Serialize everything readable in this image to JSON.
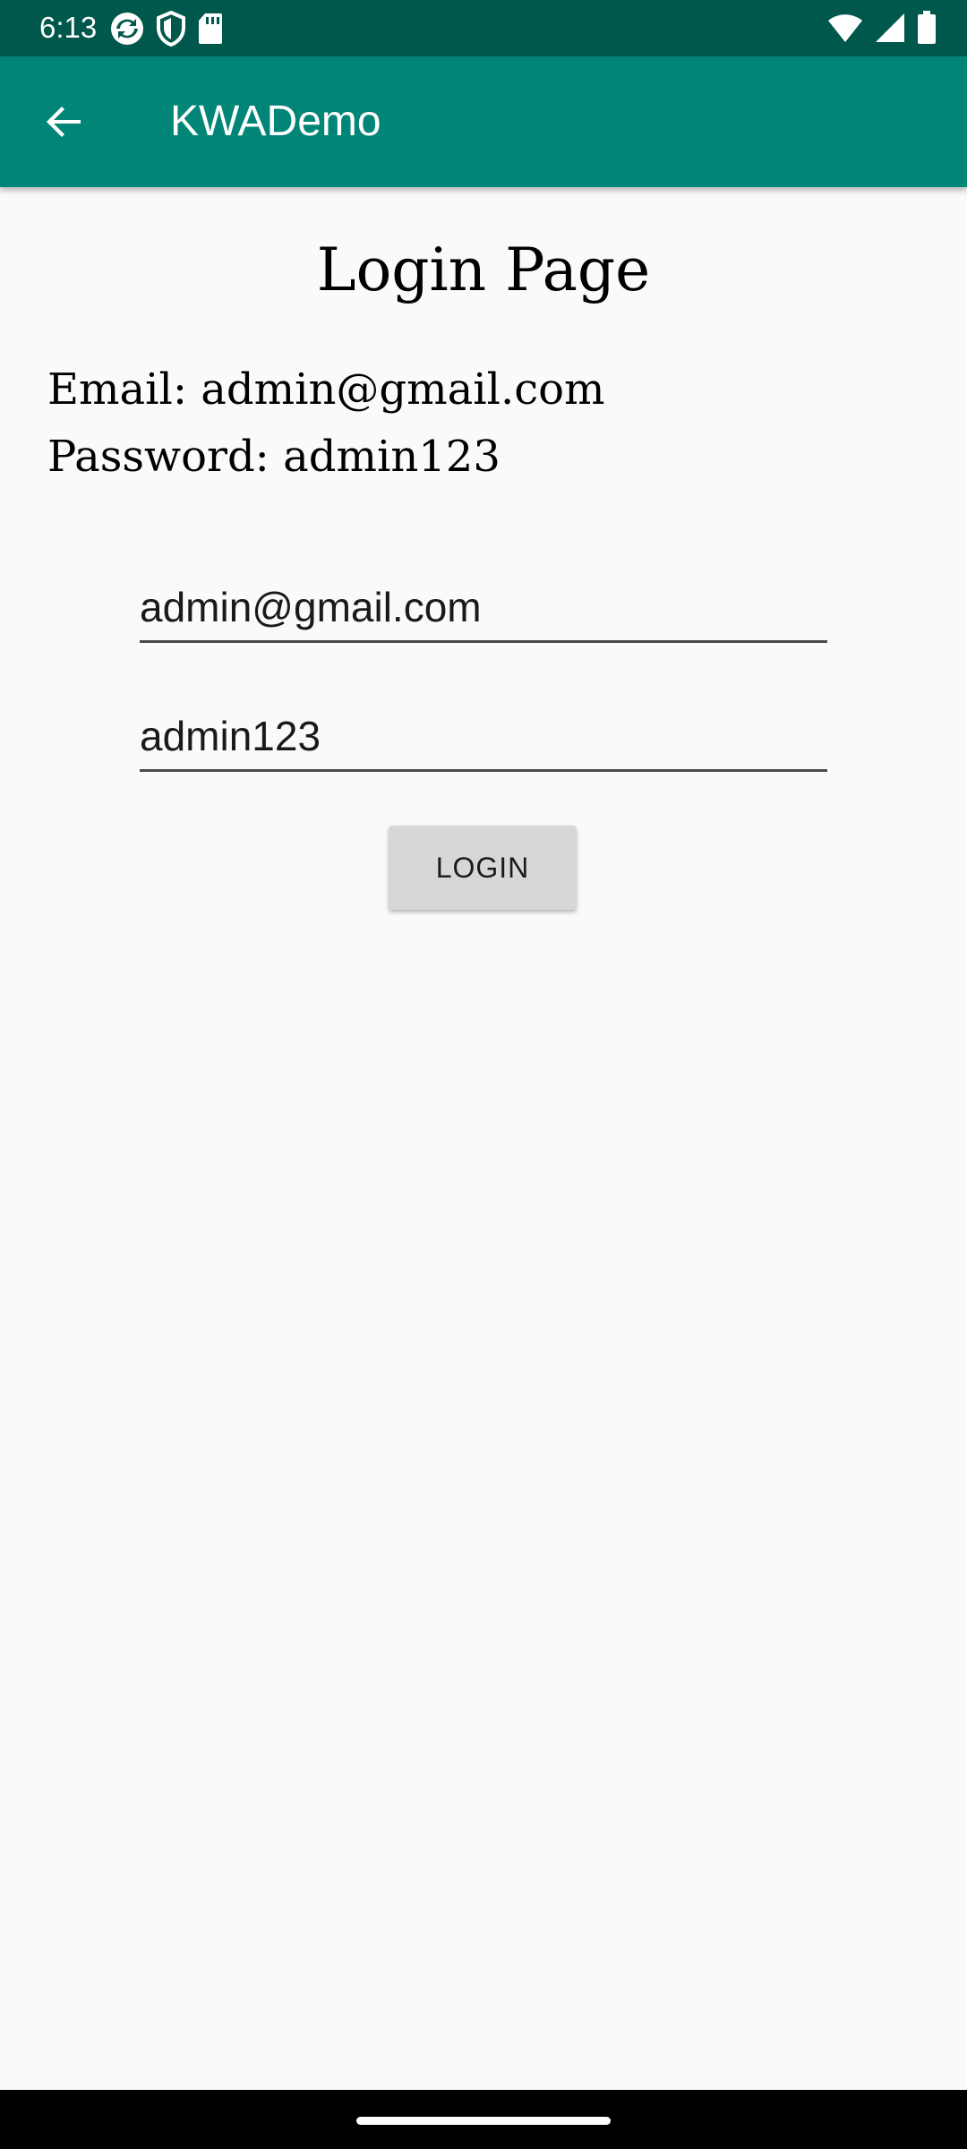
{
  "status_bar": {
    "time": "6:13",
    "left_icons": [
      "sync-icon",
      "shield-icon",
      "sd-card-icon"
    ],
    "right_icons": [
      "wifi-icon",
      "signal-icon",
      "battery-icon"
    ],
    "background": "#00574b"
  },
  "app_bar": {
    "title": "KWADemo",
    "back_icon": "arrow-back-icon",
    "background": "#008577"
  },
  "content": {
    "heading": "Login Page",
    "email_hint": "Email: admin@gmail.com",
    "password_hint": "Password: admin123",
    "email_field": {
      "value": "admin@gmail.com"
    },
    "password_field": {
      "value": "admin123"
    },
    "login_label": "LOGIN"
  },
  "colors": {
    "page_background": "#fafafa",
    "button_background": "#d6d7d7"
  }
}
